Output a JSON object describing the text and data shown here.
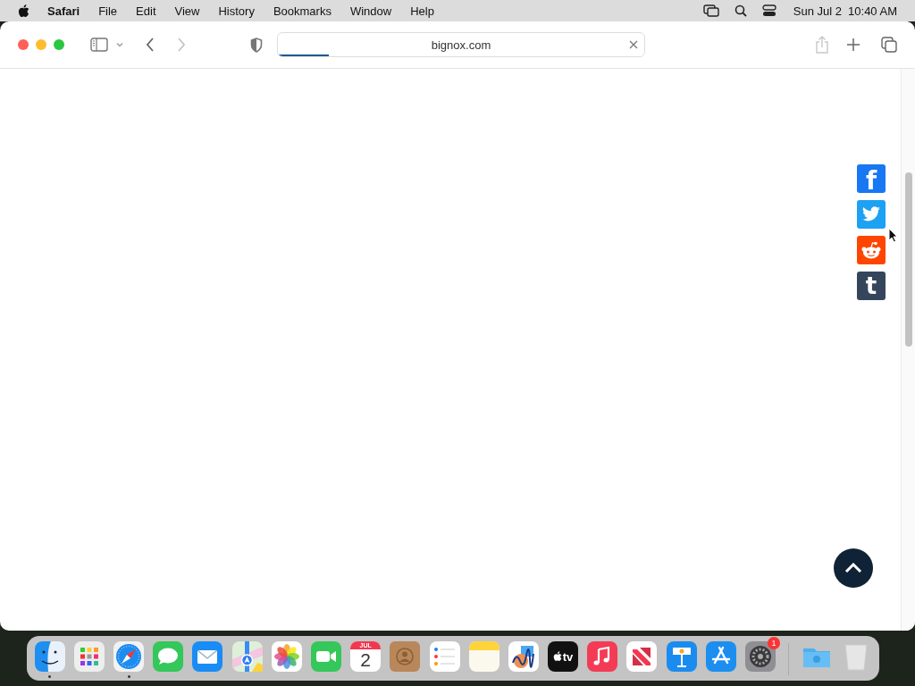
{
  "menu_bar": {
    "app_name": "Safari",
    "menus": [
      "File",
      "Edit",
      "View",
      "History",
      "Bookmarks",
      "Window",
      "Help"
    ],
    "date": "Sun Jul 2",
    "time": "10:40 AM"
  },
  "browser": {
    "url": "bignox.com",
    "load_progress": {
      "level": 0.14
    },
    "back_disabled": false,
    "forward_disabled": true,
    "share_disabled": true
  },
  "page": {
    "share_buttons": [
      {
        "kind": "facebook",
        "glyph": "f",
        "color": "#1877f2"
      },
      {
        "kind": "twitter",
        "color": "#1da1f2"
      },
      {
        "kind": "reddit",
        "color": "#ff4500"
      },
      {
        "kind": "tumblr",
        "glyph": "t",
        "color": "#35465c"
      }
    ],
    "back_to_top": {
      "color": "#0f2236"
    }
  },
  "dock": {
    "apps": [
      {
        "kind": "finder",
        "running": true
      },
      {
        "kind": "launchpad",
        "running": false
      },
      {
        "kind": "safari",
        "running": true
      },
      {
        "kind": "messages",
        "running": false
      },
      {
        "kind": "mail",
        "running": false
      },
      {
        "kind": "maps",
        "running": false
      },
      {
        "kind": "photos",
        "running": false
      },
      {
        "kind": "facetime",
        "running": false
      },
      {
        "kind": "calendar",
        "month": "JUL",
        "day": "2",
        "running": false
      },
      {
        "kind": "contacts",
        "running": false
      },
      {
        "kind": "reminders",
        "running": false
      },
      {
        "kind": "notes",
        "running": false
      },
      {
        "kind": "freeform",
        "running": false
      },
      {
        "kind": "tv",
        "label": "tv",
        "running": false
      },
      {
        "kind": "music",
        "running": false
      },
      {
        "kind": "news",
        "running": false
      },
      {
        "kind": "keynote",
        "running": false
      },
      {
        "kind": "appstore",
        "running": false
      },
      {
        "kind": "settings",
        "badge": "1",
        "running": false
      }
    ],
    "others": [
      {
        "kind": "downloads"
      },
      {
        "kind": "trash"
      }
    ]
  }
}
